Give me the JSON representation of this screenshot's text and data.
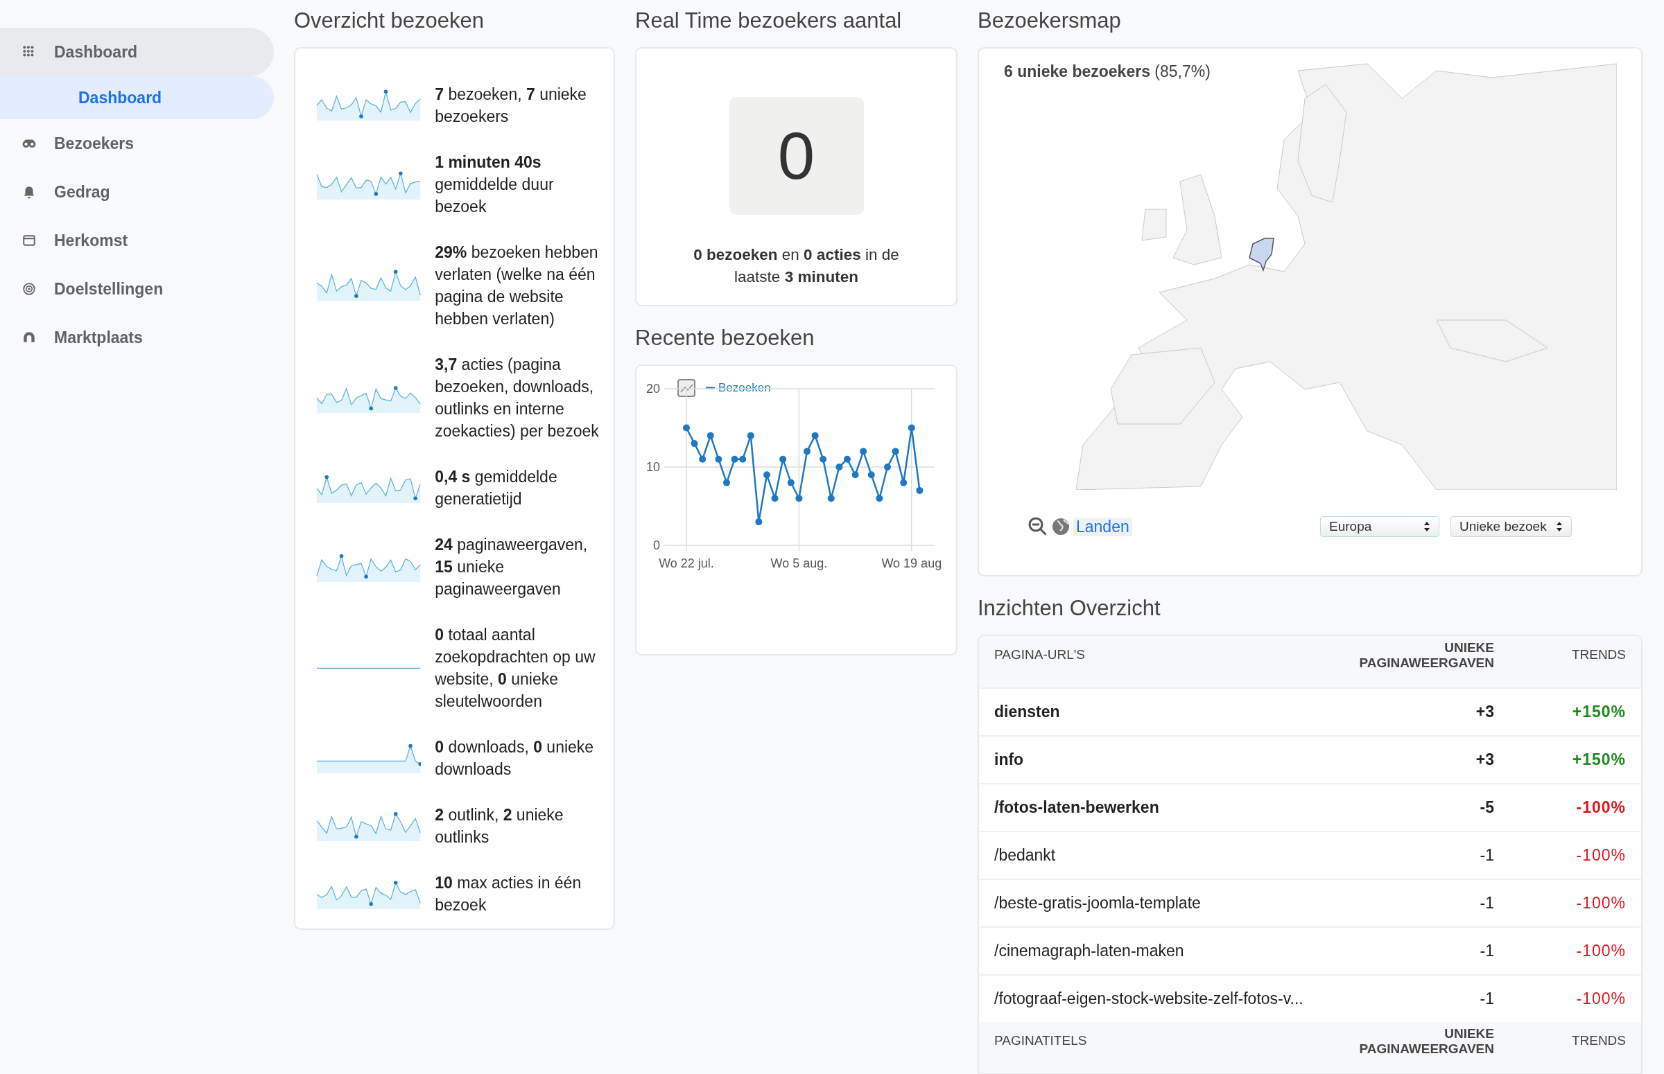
{
  "sidebar": {
    "items": [
      {
        "label": "Dashboard",
        "selected": false,
        "expanded": true,
        "children": [
          {
            "label": "Dashboard",
            "selected": true
          }
        ]
      },
      {
        "label": "Bezoekers",
        "selected": false,
        "expanded": false
      },
      {
        "label": "Gedrag",
        "selected": false,
        "expanded": false
      },
      {
        "label": "Herkomst",
        "selected": false,
        "expanded": false
      },
      {
        "label": "Doelstellingen",
        "selected": false,
        "expanded": false
      },
      {
        "label": "Marktplaats",
        "selected": false,
        "expanded": false
      }
    ]
  },
  "overview": {
    "title": "Overzicht bezoeken",
    "rows": [
      {
        "text": "**7** bezoeken, **7** unieke bezoekers"
      },
      {
        "text": "**1 minuten 40s** gemiddelde duur bezoek"
      },
      {
        "text": "**29%** bezoeken hebben verlaten (welke na één pagina de website hebben verlaten)"
      },
      {
        "text": "**3,7** acties (pagina bezoeken, downloads, outlinks en interne zoekacties) per bezoek"
      },
      {
        "text": "**0,4 s** gemiddelde generatietijd"
      },
      {
        "text": "**24** paginaweergaven, **15** unieke paginaweergaven"
      },
      {
        "text": "**0** totaal aantal zoekopdrachten op uw website, **0** unieke sleutelwoorden"
      },
      {
        "text": "**0** downloads, **0** unieke downloads"
      },
      {
        "text": "**2** outlink, **2** unieke outlinks"
      },
      {
        "text": "**10** max acties in één bezoek"
      }
    ]
  },
  "realtime": {
    "title": "Real Time bezoekers aantal",
    "counter": "0",
    "summary": "**0 bezoeken** en **0 acties** in de laatste **3 minuten**"
  },
  "recent": {
    "title": "Recente bezoeken",
    "chart_data": {
      "type": "line",
      "categories": [
        "Wo 22 jul.",
        null,
        null,
        null,
        null,
        null,
        null,
        null,
        null,
        null,
        null,
        null,
        null,
        null,
        "Wo 5 aug.",
        null,
        null,
        null,
        null,
        null,
        null,
        null,
        null,
        null,
        null,
        null,
        null,
        null,
        "Wo 19 aug",
        null
      ],
      "grid": true,
      "series": [
        {
          "name": "Bezoeken",
          "color": "#1f78c1",
          "marker": "circle",
          "values": [
            15,
            13,
            11,
            14,
            11,
            8,
            11,
            11,
            14,
            3,
            9,
            6,
            11,
            8,
            6,
            12,
            14,
            11,
            6,
            10,
            11,
            9,
            12,
            9,
            6,
            10,
            12,
            8,
            15,
            7
          ]
        }
      ],
      "ylim": [
        0,
        20
      ],
      "yticks": [
        0,
        10,
        20
      ]
    }
  },
  "map": {
    "title": "Bezoekersmap",
    "summary": "**6 unieke bezoekers** (85,7%)",
    "link": "Landen",
    "region_select": "Europa",
    "metric_select": "Unieke bezoek"
  },
  "insights": {
    "title": "Inzichten Overzicht",
    "tables": [
      {
        "columns": [
          "PAGINA-URL'S",
          "UNIEKE PAGINAWEERGAVEN",
          "TRENDS"
        ],
        "rows": [
          {
            "page": "diensten",
            "change": "+3",
            "trend": "+150%",
            "color": "#1d8a1d",
            "emphasized": true
          },
          {
            "page": "info",
            "change": "+3",
            "trend": "+150%",
            "color": "#1d8a1d",
            "emphasized": true
          },
          {
            "page": "/fotos-laten-bewerken",
            "change": "-5",
            "trend": "-100%",
            "color": "#e0161b",
            "emphasized": true
          },
          {
            "page": "/bedankt",
            "change": "-1",
            "trend": "-100%",
            "color": "#e0161b",
            "emphasized": false
          },
          {
            "page": "/beste-gratis-joomla-template",
            "change": "-1",
            "trend": "-100%",
            "color": "#e0161b",
            "emphasized": false
          },
          {
            "page": "/cinemagraph-laten-maken",
            "change": "-1",
            "trend": "-100%",
            "color": "#e0161b",
            "emphasized": false
          },
          {
            "page": "/fotograaf-eigen-stock-website-zelf-fotos-v...",
            "change": "-1",
            "trend": "-100%",
            "color": "#e0161b",
            "emphasized": false
          }
        ]
      },
      {
        "columns": [
          "PAGINATITELS",
          "UNIEKE PAGINAWEERGAVEN",
          "TRENDS"
        ]
      }
    ]
  }
}
